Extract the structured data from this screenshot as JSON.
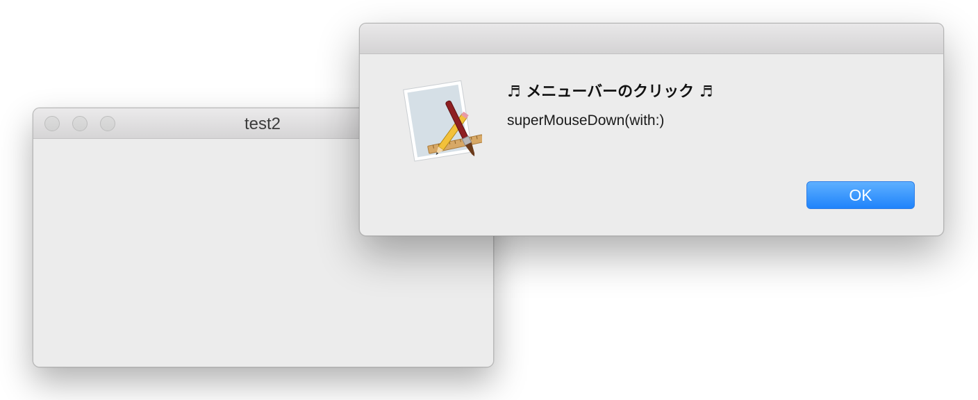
{
  "background_window": {
    "title": "test2"
  },
  "alert": {
    "heading": "♬ メニューバーのクリック ♬",
    "message": "superMouseDown(with:)",
    "ok_label": "OK",
    "icon": "app-icon"
  },
  "colors": {
    "ok_button": "#1f83fb",
    "window_bg": "#ececec"
  }
}
